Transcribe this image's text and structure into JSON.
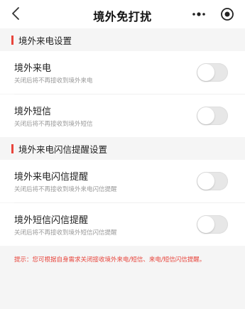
{
  "nav": {
    "back_icon": "chevron-left-icon",
    "title": "境外免打扰",
    "more_icon": "more-dots-icon",
    "target_icon": "target-icon"
  },
  "sections": [
    {
      "title": "境外来电设置",
      "items": [
        {
          "label": "境外来电",
          "desc": "关闭后将不再接收到境外来电",
          "enabled": false
        },
        {
          "label": "境外短信",
          "desc": "关闭后将不再接收到境外短信",
          "enabled": false
        }
      ]
    },
    {
      "title": "境外来电闪信提醒设置",
      "items": [
        {
          "label": "境外来电闪信提醒",
          "desc": "关闭后将不再接收到境外来电闪信提醒",
          "enabled": false
        },
        {
          "label": "境外短信闪信提醒",
          "desc": "关闭后将不再接收到境外短信闪信提醒",
          "enabled": false
        }
      ]
    }
  ],
  "hint": "提示：您可根据自身需求关闭接收境外来电/短信、来电/短信闪信提醒。",
  "colors": {
    "accent": "#e8453c",
    "background": "#f5f5f5",
    "toggle_off": "#e7e7e7"
  }
}
